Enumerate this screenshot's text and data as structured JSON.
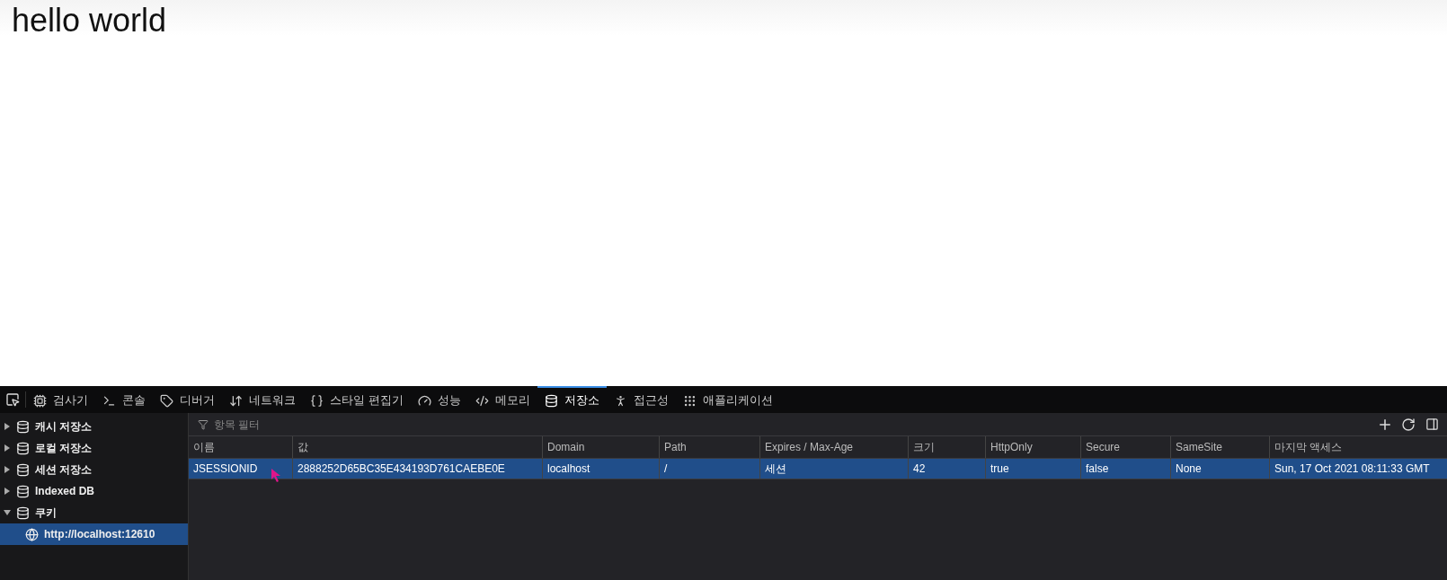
{
  "page": {
    "heading": "hello world"
  },
  "devtools": {
    "tabs": [
      {
        "label": "검사기",
        "selected": false
      },
      {
        "label": "콘솔",
        "selected": false
      },
      {
        "label": "디버거",
        "selected": false
      },
      {
        "label": "네트워크",
        "selected": false
      },
      {
        "label": "스타일 편집기",
        "selected": false
      },
      {
        "label": "성능",
        "selected": false
      },
      {
        "label": "메모리",
        "selected": false
      },
      {
        "label": "저장소",
        "selected": true
      },
      {
        "label": "접근성",
        "selected": false
      },
      {
        "label": "애플리케이션",
        "selected": false
      }
    ],
    "sidebar": {
      "items": [
        {
          "label": "캐시 저장소",
          "expanded": false
        },
        {
          "label": "로컬 저장소",
          "expanded": false
        },
        {
          "label": "세션 저장소",
          "expanded": false
        },
        {
          "label": "Indexed DB",
          "expanded": false
        },
        {
          "label": "쿠키",
          "expanded": true,
          "children": [
            {
              "label": "http://localhost:12610",
              "selected": true
            }
          ]
        }
      ]
    },
    "filter": {
      "placeholder": "항목 필터"
    },
    "table": {
      "columns": [
        "이름",
        "값",
        "Domain",
        "Path",
        "Expires / Max-Age",
        "크기",
        "HttpOnly",
        "Secure",
        "SameSite",
        "마지막 액세스"
      ],
      "rows": [
        {
          "selected": true,
          "cells": [
            "JSESSIONID",
            "2888252D65BC35E434193D761CAEBE0E",
            "localhost",
            "/",
            "세션",
            "42",
            "true",
            "false",
            "None",
            "Sun, 17 Oct 2021 08:11:33 GMT"
          ]
        }
      ]
    }
  }
}
